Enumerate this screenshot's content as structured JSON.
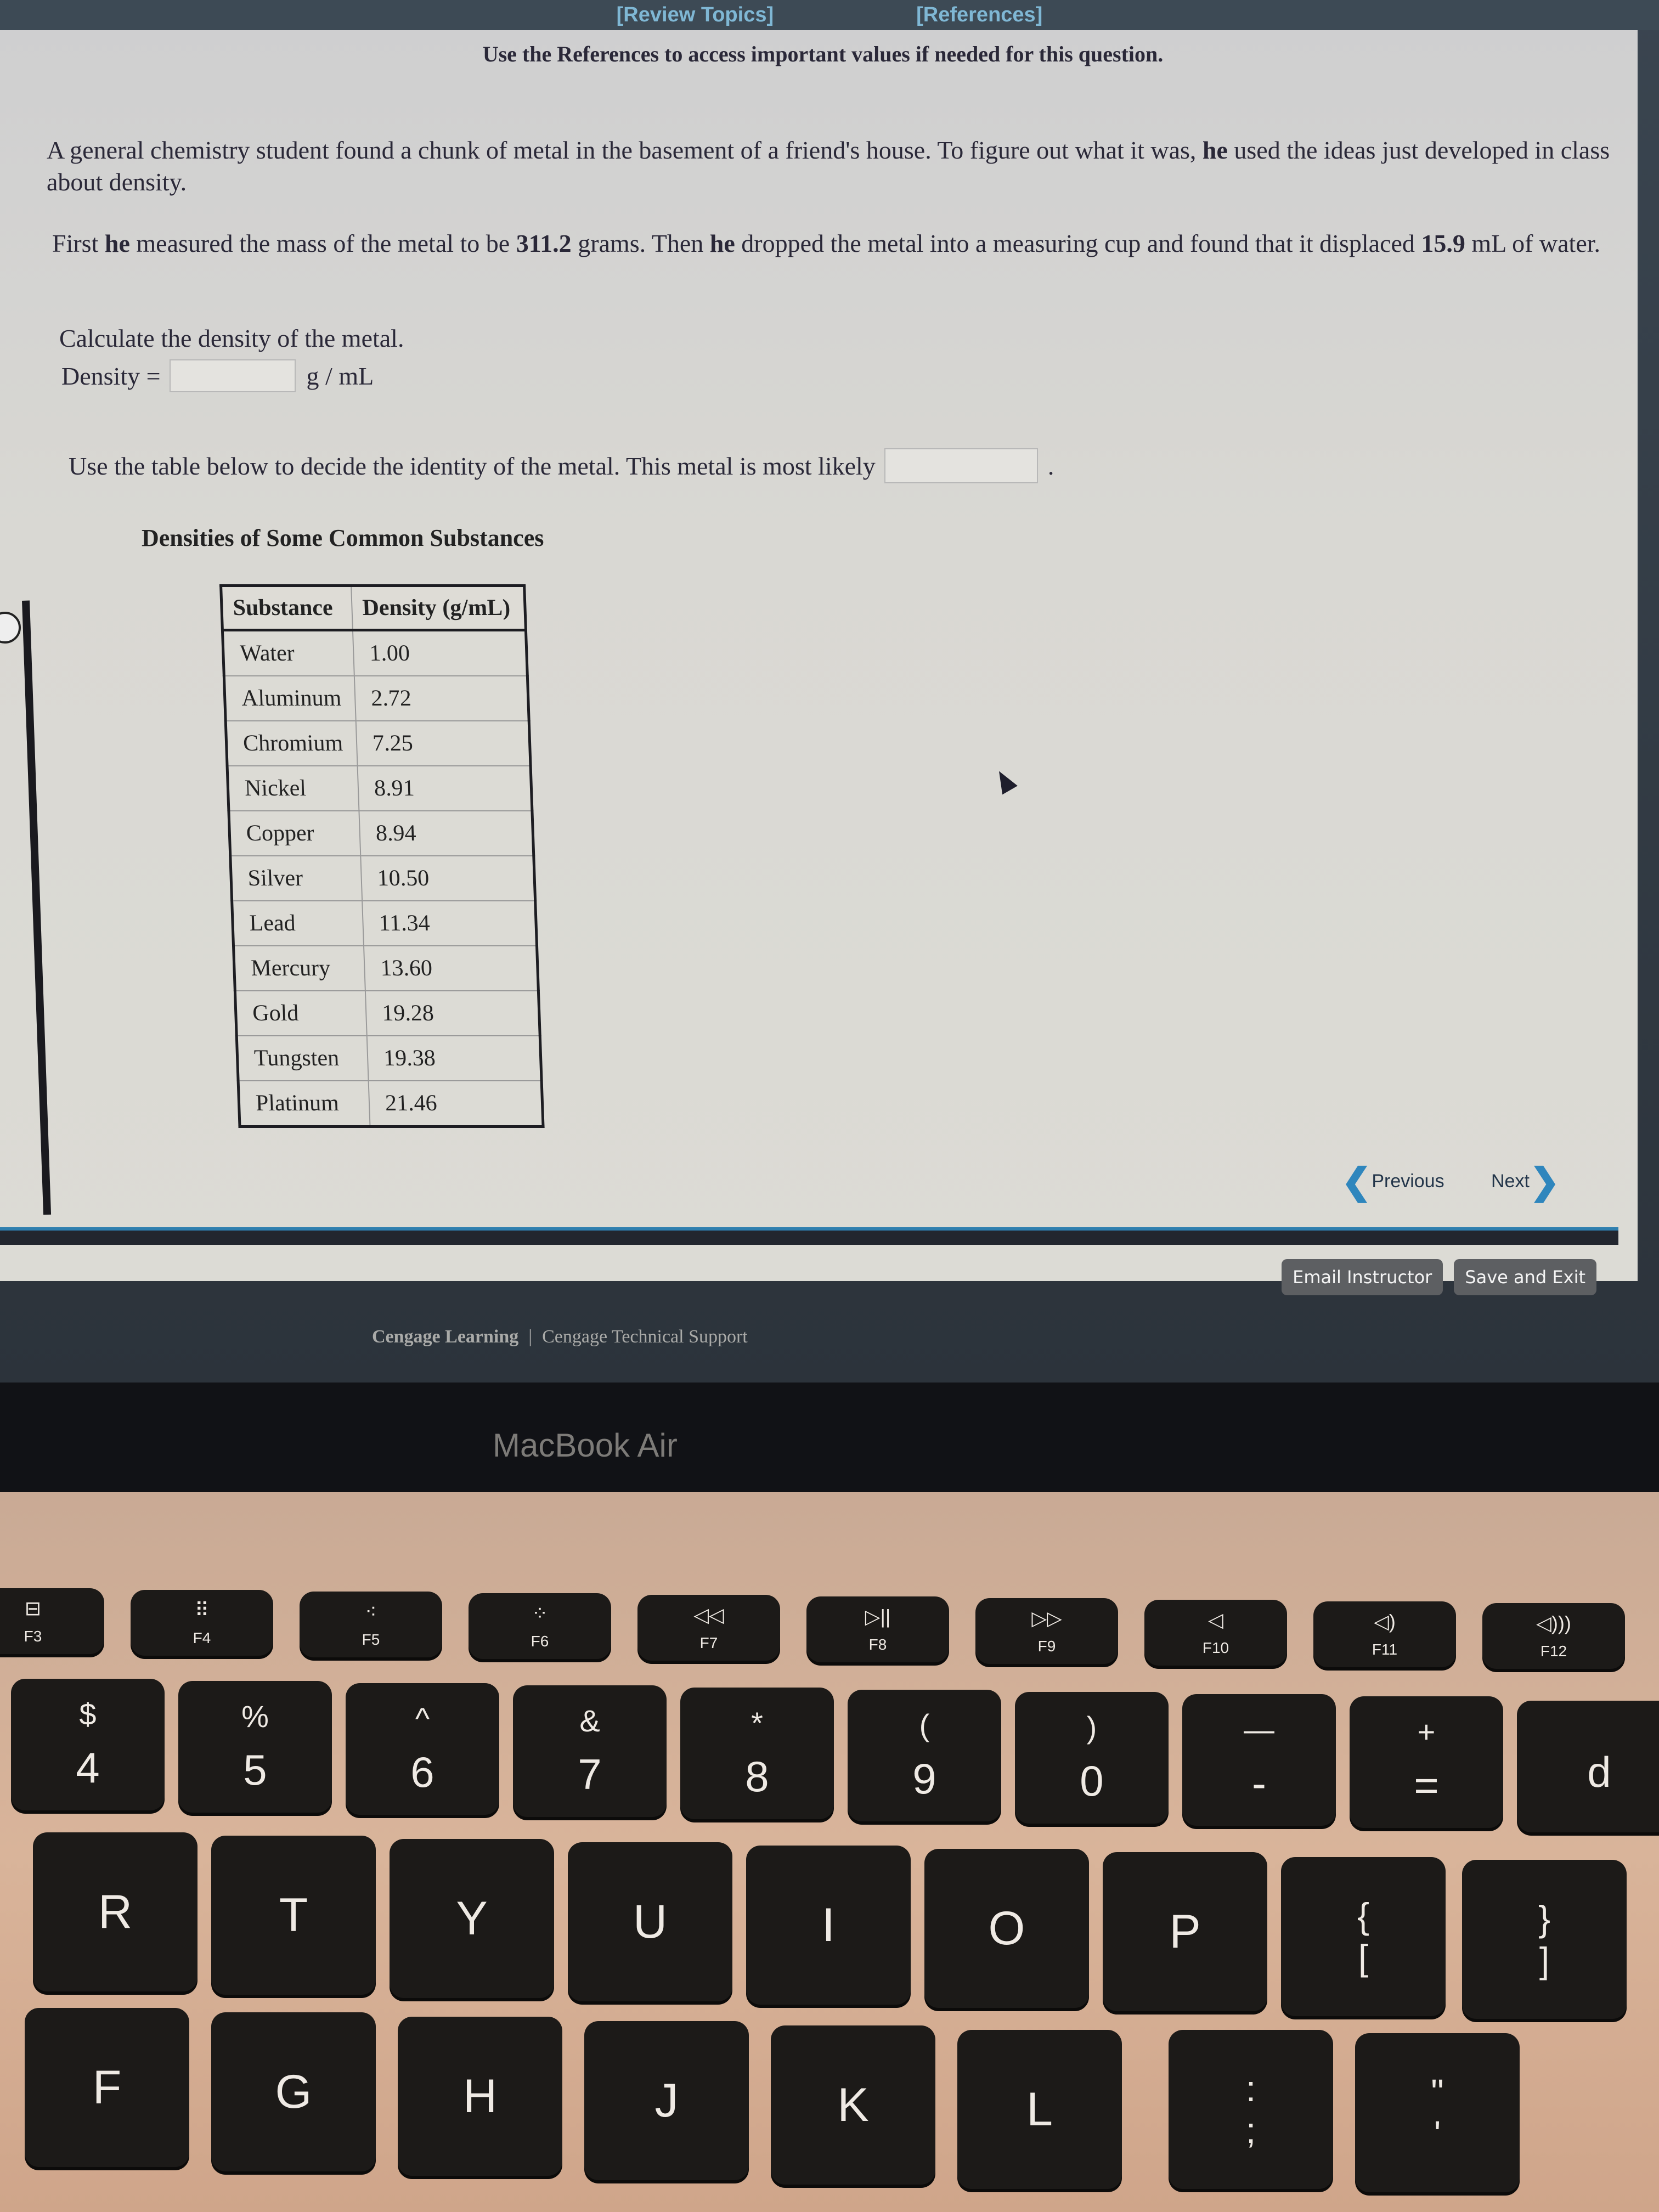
{
  "header": {
    "review_topics": "[Review Topics]",
    "references": "[References]"
  },
  "reference_note": "Use the References to access important values if needed for this question.",
  "problem": {
    "p1_before": "A general chemistry student found a chunk of metal in the basement of a friend's house. To figure out what it was, ",
    "p1_bold": "he",
    "p1_after": " used the ideas just developed in class about density.",
    "p2_a": "First ",
    "p2_b": "he",
    "p2_c": " measured the mass of the metal to be ",
    "mass_value": "311.2",
    "p2_d": " grams. Then ",
    "p2_e": "he",
    "p2_f": " dropped the metal into a measuring cup and found that it displaced ",
    "volume_value": "15.9",
    "p2_g": " mL of water."
  },
  "question1": {
    "prompt": "Calculate the density of the metal.",
    "label": "Density =",
    "value": "",
    "unit": "g / mL"
  },
  "question2": {
    "prompt": "Use the table below to decide the identity of the metal. This metal is most likely",
    "value": "",
    "trailing": "."
  },
  "table": {
    "title": "Densities of Some Common Substances",
    "headers": [
      "Substance",
      "Density (g/mL)"
    ],
    "rows": [
      [
        "Water",
        "1.00"
      ],
      [
        "Aluminum",
        "2.72"
      ],
      [
        "Chromium",
        "7.25"
      ],
      [
        "Nickel",
        "8.91"
      ],
      [
        "Copper",
        "8.94"
      ],
      [
        "Silver",
        "10.50"
      ],
      [
        "Lead",
        "11.34"
      ],
      [
        "Mercury",
        "13.60"
      ],
      [
        "Gold",
        "19.28"
      ],
      [
        "Tungsten",
        "19.38"
      ],
      [
        "Platinum",
        "21.46"
      ]
    ]
  },
  "navigation": {
    "previous": "Previous",
    "next": "Next"
  },
  "actions": {
    "email_instructor": "Email Instructor",
    "save_and_exit": "Save and Exit"
  },
  "footer": {
    "cengage_learning": "Cengage Learning",
    "separator": "|",
    "technical_support": "Cengage Technical Support"
  },
  "device": {
    "label": "MacBook Air",
    "function_keys": [
      {
        "label": "F3",
        "icon": "mission-control-icon",
        "glyph": "⊟"
      },
      {
        "label": "F4",
        "icon": "launchpad-icon",
        "glyph": "⠿"
      },
      {
        "label": "F5",
        "icon": "keyboard-brightness-down-icon",
        "glyph": "⁖"
      },
      {
        "label": "F6",
        "icon": "keyboard-brightness-up-icon",
        "glyph": "⁘"
      },
      {
        "label": "F7",
        "icon": "rewind-icon",
        "glyph": "◁◁"
      },
      {
        "label": "F8",
        "icon": "play-pause-icon",
        "glyph": "▷||"
      },
      {
        "label": "F9",
        "icon": "fast-forward-icon",
        "glyph": "▷▷"
      },
      {
        "label": "F10",
        "icon": "mute-icon",
        "glyph": "◁"
      },
      {
        "label": "F11",
        "icon": "volume-down-icon",
        "glyph": "◁)"
      },
      {
        "label": "F12",
        "icon": "volume-up-icon",
        "glyph": "◁)))"
      }
    ],
    "number_keys": [
      {
        "top": "$",
        "bottom": "4"
      },
      {
        "top": "%",
        "bottom": "5"
      },
      {
        "top": "^",
        "bottom": "6"
      },
      {
        "top": "&",
        "bottom": "7"
      },
      {
        "top": "*",
        "bottom": "8"
      },
      {
        "top": "(",
        "bottom": "9"
      },
      {
        "top": ")",
        "bottom": "0"
      },
      {
        "top": "—",
        "bottom": "-"
      },
      {
        "top": "+",
        "bottom": "="
      }
    ],
    "letter_row_1": [
      "R",
      "T",
      "Y",
      "U",
      "I",
      "O",
      "P"
    ],
    "bracket_keys": [
      {
        "top": "{",
        "bottom": "["
      },
      {
        "top": "}",
        "bottom": "]"
      }
    ],
    "letter_row_2": [
      "F",
      "G",
      "H",
      "J",
      "K",
      "L"
    ],
    "punct_keys": [
      {
        "top": ":",
        "bottom": ";"
      },
      {
        "top": "\"",
        "bottom": "'"
      }
    ],
    "edge_key_partial": "d"
  }
}
